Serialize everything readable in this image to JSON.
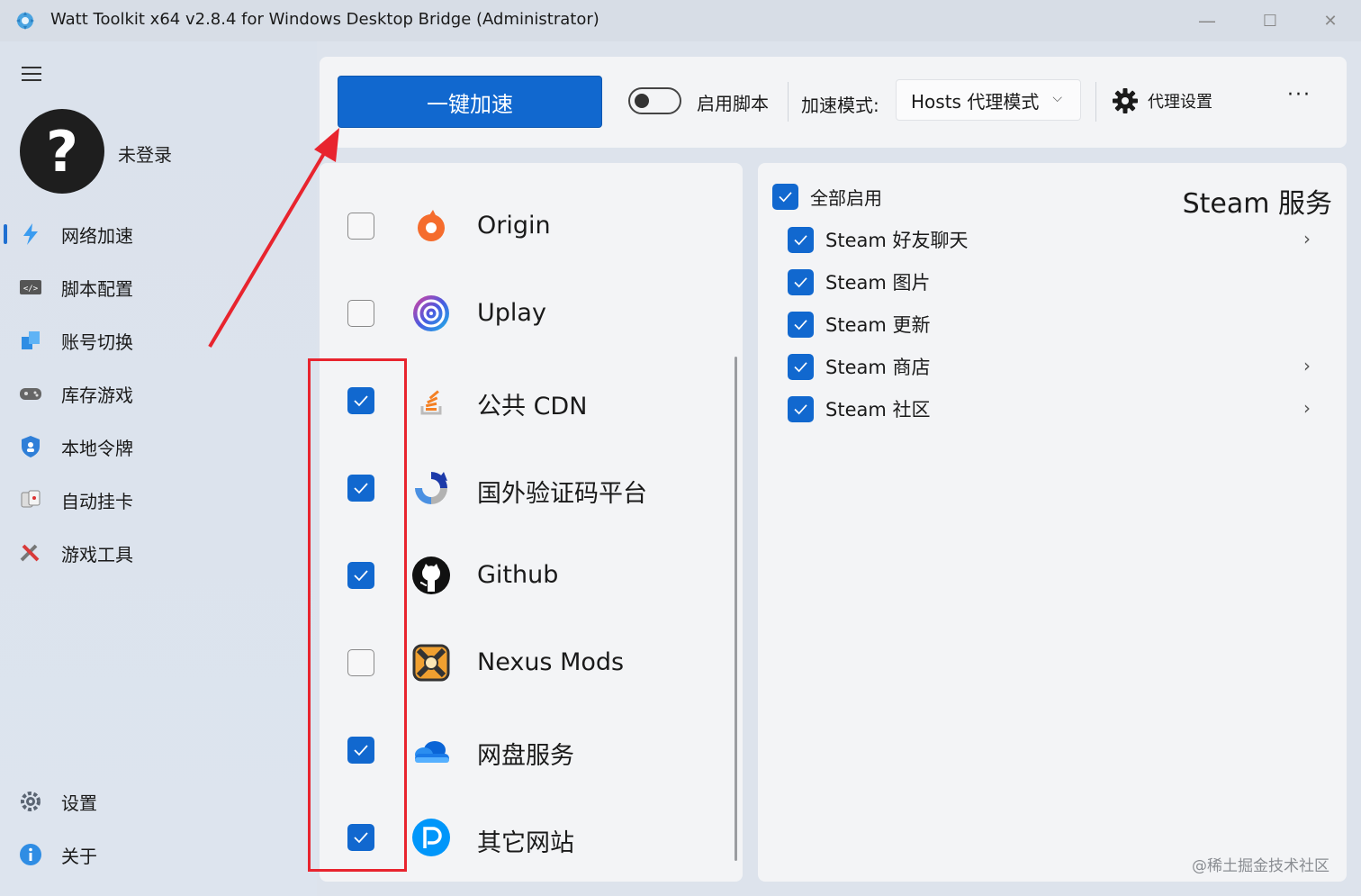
{
  "window": {
    "title": "Watt Toolkit x64 v2.8.4 for Windows Desktop Bridge (Administrator)",
    "minimize": "—",
    "maximize": "☐",
    "close": "✕"
  },
  "user": {
    "avatar_glyph": "?",
    "status": "未登录"
  },
  "sidebar": {
    "items": [
      {
        "label": "网络加速",
        "icon": "lightning-icon"
      },
      {
        "label": "脚本配置",
        "icon": "code-icon"
      },
      {
        "label": "账号切换",
        "icon": "switch-icon"
      },
      {
        "label": "库存游戏",
        "icon": "gamepad-icon"
      },
      {
        "label": "本地令牌",
        "icon": "shield-icon"
      },
      {
        "label": "自动挂卡",
        "icon": "cards-icon"
      },
      {
        "label": "游戏工具",
        "icon": "tools-icon"
      }
    ],
    "bottom": [
      {
        "label": "设置",
        "icon": "gear-icon"
      },
      {
        "label": "关于",
        "icon": "info-icon"
      }
    ]
  },
  "toolbar": {
    "accelerate_label": "一键加速",
    "script_toggle_label": "启用脚本",
    "script_enabled": false,
    "mode_label": "加速模式:",
    "mode_value": "Hosts 代理模式",
    "proxy_settings_label": "代理设置",
    "more_label": "···"
  },
  "platforms": [
    {
      "name": "Origin",
      "checked": false,
      "icon": "origin-icon"
    },
    {
      "name": "Uplay",
      "checked": false,
      "icon": "uplay-icon"
    },
    {
      "name": "公共 CDN",
      "checked": true,
      "icon": "cdn-icon"
    },
    {
      "name": "国外验证码平台",
      "checked": true,
      "icon": "recaptcha-icon"
    },
    {
      "name": "Github",
      "checked": true,
      "icon": "github-icon"
    },
    {
      "name": "Nexus Mods",
      "checked": false,
      "icon": "nexus-icon"
    },
    {
      "name": "网盘服务",
      "checked": true,
      "icon": "cloud-icon"
    },
    {
      "name": "其它网站",
      "checked": true,
      "icon": "pixiv-icon"
    }
  ],
  "services": {
    "title": "Steam 服务",
    "enable_all_label": "全部启用",
    "items": [
      {
        "label": "Steam 好友聊天",
        "checked": true,
        "has_chevron": true
      },
      {
        "label": "Steam 图片",
        "checked": true,
        "has_chevron": false
      },
      {
        "label": "Steam 更新",
        "checked": true,
        "has_chevron": false
      },
      {
        "label": "Steam 商店",
        "checked": true,
        "has_chevron": true
      },
      {
        "label": "Steam 社区",
        "checked": true,
        "has_chevron": true
      }
    ]
  },
  "watermark": "@稀土掘金技术社区",
  "colors": {
    "accent": "#1168cf",
    "annotation_red": "#e8242e"
  }
}
